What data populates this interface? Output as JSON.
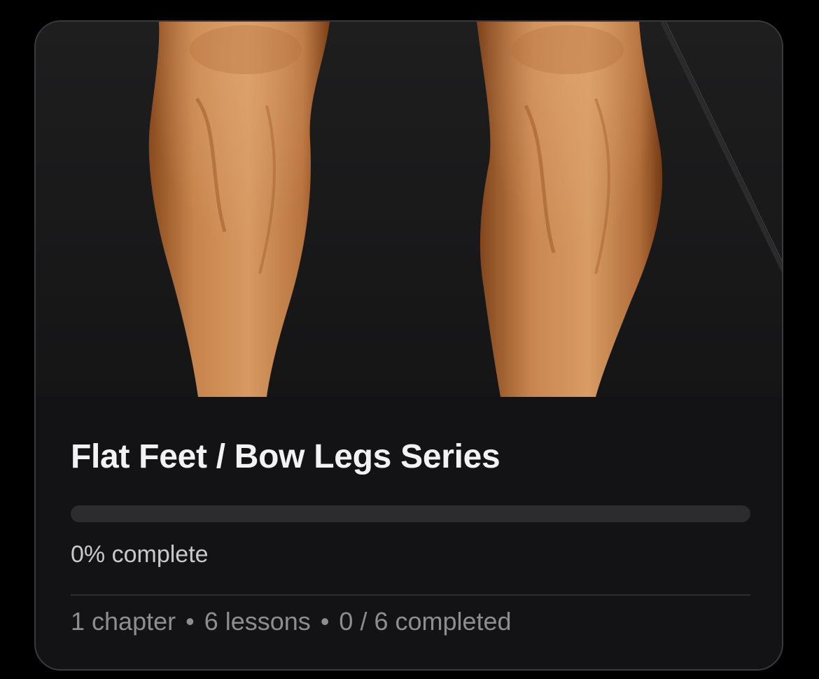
{
  "course": {
    "title": "Flat Feet / Bow Legs Series",
    "progress_percent": 0,
    "progress_text": "0% complete",
    "meta": {
      "chapters": "1 chapter",
      "lessons": "6 lessons",
      "completed": "0 / 6 completed",
      "separator": "•"
    },
    "hero_image": "legs-calves-photo"
  },
  "colors": {
    "background": "#000000",
    "card": "#131315",
    "title": "#f2f2f4",
    "progress_track": "#2c2c2f",
    "meta_text": "#8d8d92"
  }
}
